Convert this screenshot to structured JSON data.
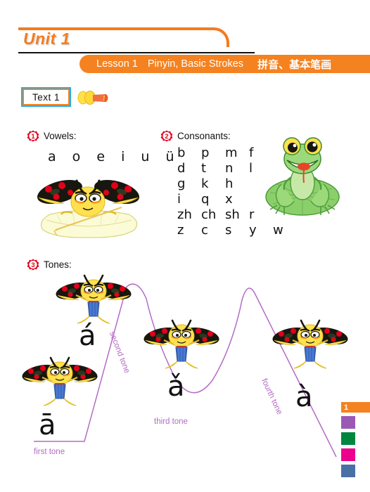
{
  "header": {
    "unit_title": "Unit 1",
    "lesson_number": "Lesson 1",
    "lesson_title_en": "Pinyin, Basic Strokes",
    "lesson_title_cn": "拼音、基本笔画",
    "banner_color": "#F58220",
    "unit_color": "#F47B20"
  },
  "text_chip": {
    "label": "Text  1",
    "border_color": "#F58220",
    "outline_color": "#29ABE2",
    "icon": "speaking-mouth-icon"
  },
  "sections": [
    {
      "number": "1",
      "label": "Vowels:"
    },
    {
      "number": "2",
      "label": "Consonants:"
    },
    {
      "number": "3",
      "label": "Tones:"
    }
  ],
  "vowels": {
    "letters": "a o e i u ü",
    "items": [
      "a",
      "o",
      "e",
      "i",
      "u",
      "ü"
    ]
  },
  "consonants": {
    "rows": [
      [
        "b",
        "p",
        "m",
        "f"
      ],
      [
        "d",
        "t",
        "n",
        "l"
      ],
      [
        "g",
        "k",
        "h"
      ],
      [
        "i",
        "q",
        "x"
      ],
      [
        "zh",
        "ch",
        "sh",
        "r"
      ],
      [
        "z",
        "c",
        "s",
        "y",
        "w"
      ]
    ]
  },
  "tones": {
    "line_color": "#B36BC4",
    "items": [
      {
        "letter": "ā",
        "name": "first tone"
      },
      {
        "letter": "á",
        "name": "second tone"
      },
      {
        "letter": "ǎ",
        "name": "third tone"
      },
      {
        "letter": "à",
        "name": "fourth tone"
      }
    ]
  },
  "legend": {
    "badge_number": "1",
    "badge_color": "#F58220",
    "swatches": [
      "#9B59B6",
      "#00853F",
      "#EC008C",
      "#4A6FA5"
    ]
  },
  "illustrations": [
    {
      "name": "ladybug-on-leaf",
      "subject": "ladybug"
    },
    {
      "name": "frog-on-lilypad",
      "subject": "frog"
    },
    {
      "name": "ladybug-first-tone",
      "subject": "ladybug"
    },
    {
      "name": "ladybug-second-tone",
      "subject": "ladybug"
    },
    {
      "name": "ladybug-third-tone",
      "subject": "ladybug"
    },
    {
      "name": "ladybug-fourth-tone",
      "subject": "ladybug"
    }
  ]
}
